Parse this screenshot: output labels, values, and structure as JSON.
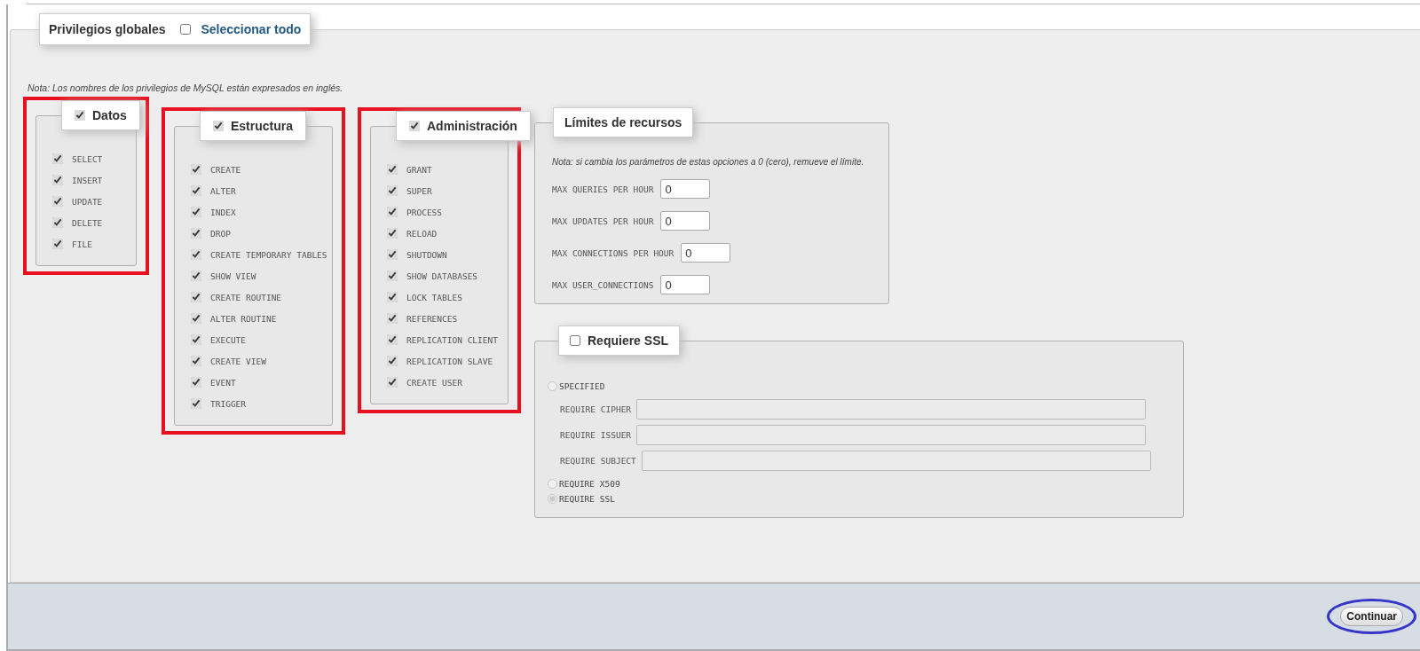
{
  "global": {
    "legend": "Privilegios globales",
    "select_all": {
      "label": "Seleccionar todo",
      "checked": false
    }
  },
  "note": "Nota: Los nombres de los privilegios de MySQL están expresados en inglés.",
  "groups": [
    {
      "legend": "Datos",
      "checked": true,
      "highlighted": true,
      "privileges": [
        {
          "label": "SELECT",
          "checked": true
        },
        {
          "label": "INSERT",
          "checked": true
        },
        {
          "label": "UPDATE",
          "checked": true
        },
        {
          "label": "DELETE",
          "checked": true
        },
        {
          "label": "FILE",
          "checked": true
        }
      ]
    },
    {
      "legend": "Estructura",
      "checked": true,
      "highlighted": true,
      "privileges": [
        {
          "label": "CREATE",
          "checked": true
        },
        {
          "label": "ALTER",
          "checked": true
        },
        {
          "label": "INDEX",
          "checked": true
        },
        {
          "label": "DROP",
          "checked": true
        },
        {
          "label": "CREATE TEMPORARY TABLES",
          "checked": true
        },
        {
          "label": "SHOW VIEW",
          "checked": true
        },
        {
          "label": "CREATE ROUTINE",
          "checked": true
        },
        {
          "label": "ALTER ROUTINE",
          "checked": true
        },
        {
          "label": "EXECUTE",
          "checked": true
        },
        {
          "label": "CREATE VIEW",
          "checked": true
        },
        {
          "label": "EVENT",
          "checked": true
        },
        {
          "label": "TRIGGER",
          "checked": true
        }
      ]
    },
    {
      "legend": "Administración",
      "checked": true,
      "highlighted": true,
      "privileges": [
        {
          "label": "GRANT",
          "checked": true
        },
        {
          "label": "SUPER",
          "checked": true
        },
        {
          "label": "PROCESS",
          "checked": true
        },
        {
          "label": "RELOAD",
          "checked": true
        },
        {
          "label": "SHUTDOWN",
          "checked": true
        },
        {
          "label": "SHOW DATABASES",
          "checked": true
        },
        {
          "label": "LOCK TABLES",
          "checked": true
        },
        {
          "label": "REFERENCES",
          "checked": true
        },
        {
          "label": "REPLICATION CLIENT",
          "checked": true
        },
        {
          "label": "REPLICATION SLAVE",
          "checked": true
        },
        {
          "label": "CREATE USER",
          "checked": true
        }
      ]
    }
  ],
  "limits": {
    "legend": "Límites de recursos",
    "note": "Nota: si cambia los parámetros de estas opciones a 0 (cero), remueve el límite.",
    "fields": [
      {
        "label": "MAX QUERIES PER HOUR",
        "value": "0"
      },
      {
        "label": "MAX UPDATES PER HOUR",
        "value": "0"
      },
      {
        "label": "MAX CONNECTIONS PER HOUR",
        "value": "0"
      },
      {
        "label": "MAX USER_CONNECTIONS",
        "value": "0"
      }
    ]
  },
  "ssl": {
    "legend": "Requiere SSL",
    "checked": false,
    "disabled": true,
    "options": [
      {
        "kind": "radio",
        "label": "SPECIFIED",
        "selected": false
      },
      {
        "kind": "field",
        "label": "REQUIRE CIPHER"
      },
      {
        "kind": "field",
        "label": "REQUIRE ISSUER"
      },
      {
        "kind": "field",
        "label": "REQUIRE SUBJECT"
      },
      {
        "kind": "radio",
        "label": "REQUIRE X509",
        "selected": false
      },
      {
        "kind": "radio",
        "label": "REQUIRE SSL",
        "selected": true
      }
    ]
  },
  "footer": {
    "button": {
      "label": "Continuar",
      "circled": true
    }
  }
}
